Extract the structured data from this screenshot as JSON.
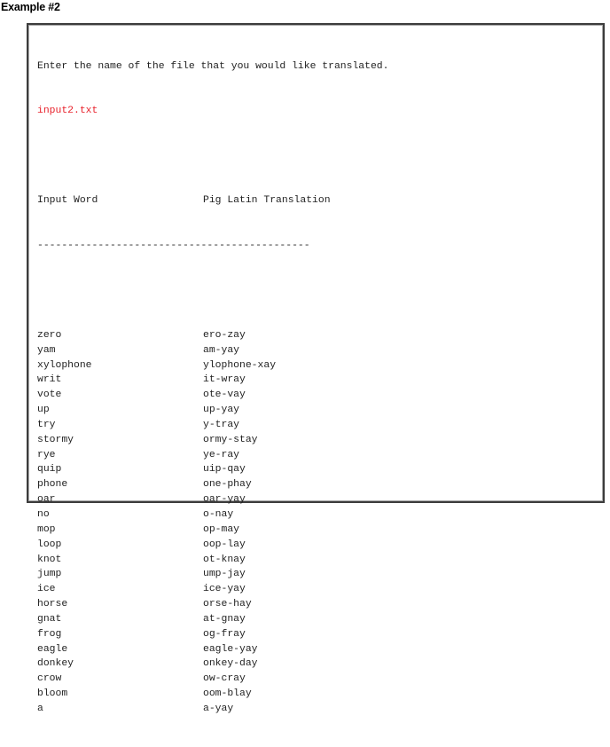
{
  "heading": "Example #2",
  "console": {
    "prompt": "Enter the name of the file that you would like translated.",
    "user_input": "input2.txt",
    "headers": {
      "input_word": "Input Word",
      "translation": "Pig Latin Translation"
    },
    "separator": "---------------------------------------------",
    "rows": [
      {
        "word": "zero",
        "translation": "ero-zay"
      },
      {
        "word": "yam",
        "translation": "am-yay"
      },
      {
        "word": "xylophone",
        "translation": "ylophone-xay"
      },
      {
        "word": "writ",
        "translation": "it-wray"
      },
      {
        "word": "vote",
        "translation": "ote-vay"
      },
      {
        "word": "up",
        "translation": "up-yay"
      },
      {
        "word": "try",
        "translation": "y-tray"
      },
      {
        "word": "stormy",
        "translation": "ormy-stay"
      },
      {
        "word": "rye",
        "translation": "ye-ray"
      },
      {
        "word": "quip",
        "translation": "uip-qay"
      },
      {
        "word": "phone",
        "translation": "one-phay"
      },
      {
        "word": "oar",
        "translation": "oar-yay"
      },
      {
        "word": "no",
        "translation": "o-nay"
      },
      {
        "word": "mop",
        "translation": "op-may"
      },
      {
        "word": "loop",
        "translation": "oop-lay"
      },
      {
        "word": "knot",
        "translation": "ot-knay"
      },
      {
        "word": "jump",
        "translation": "ump-jay"
      },
      {
        "word": "ice",
        "translation": "ice-yay"
      },
      {
        "word": "horse",
        "translation": "orse-hay"
      },
      {
        "word": "gnat",
        "translation": "at-gnay"
      },
      {
        "word": "frog",
        "translation": "og-fray"
      },
      {
        "word": "eagle",
        "translation": "eagle-yay"
      },
      {
        "word": "donkey",
        "translation": "onkey-day"
      },
      {
        "word": "crow",
        "translation": "ow-cray"
      },
      {
        "word": "bloom",
        "translation": "oom-blay"
      },
      {
        "word": "a",
        "translation": "a-yay"
      }
    ]
  },
  "colors": {
    "user_input": "#e8202a",
    "text": "#222222",
    "border": "#3c3c3c"
  }
}
